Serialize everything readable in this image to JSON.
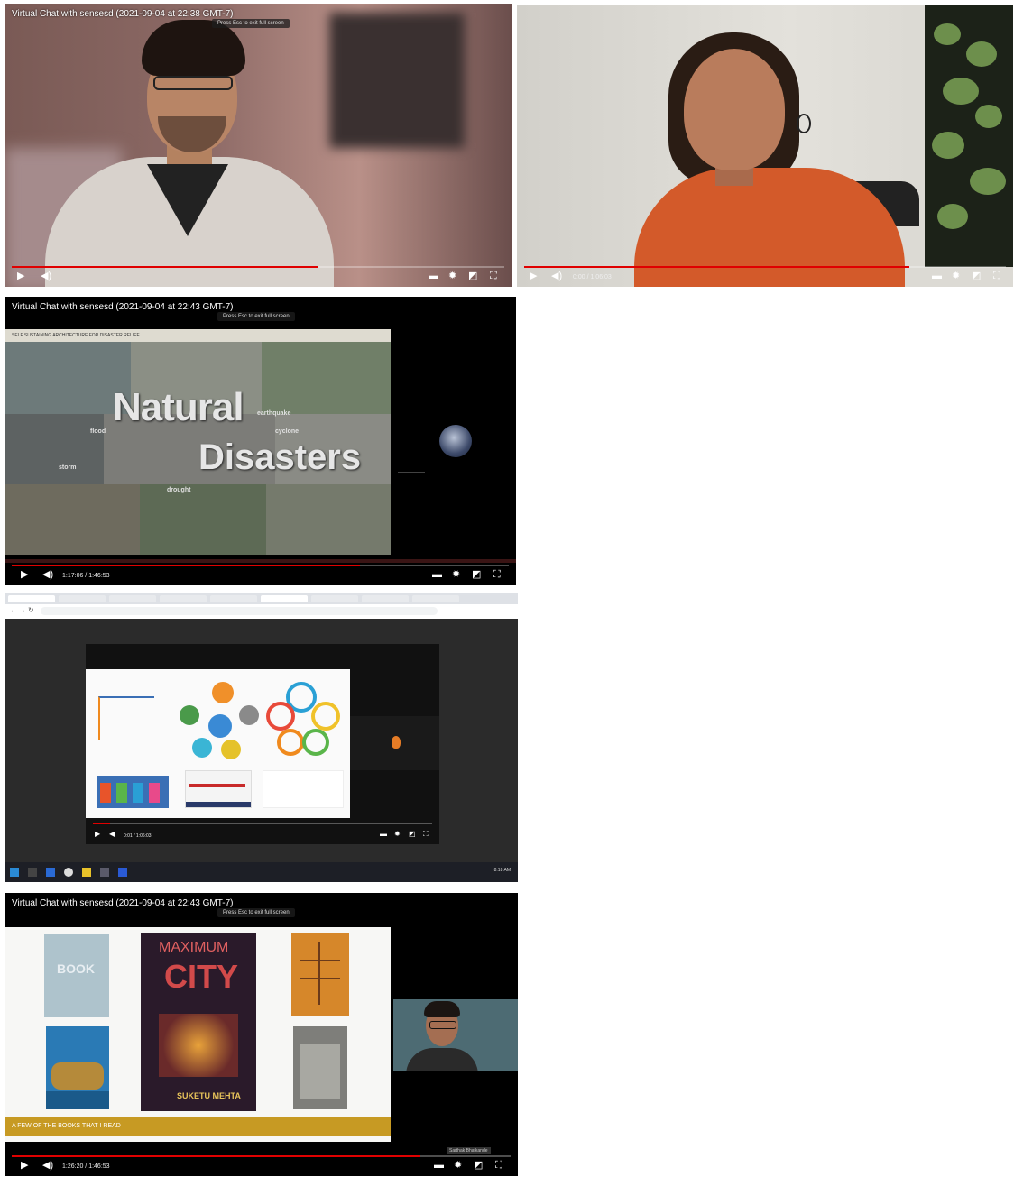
{
  "panel1": {
    "title": "Virtual Chat with sensesd (2021-09-04 at 22:38 GMT-7)",
    "hint": "Press Esc to exit full screen",
    "progress": 0.62
  },
  "panel2": {
    "time": "0:00 / 1:06:03",
    "progress": 0.8
  },
  "panel3": {
    "title": "Virtual Chat with sensesd (2021-09-04 at 22:43 GMT-7)",
    "hint": "Press Esc to exit full screen",
    "slide_banner": "SELF SUSTAINING ARCHITECTURE FOR DISASTER RELIEF",
    "word1": "Natural",
    "word2": "Disasters",
    "time": "1:17:06 / 1:46:53",
    "progress": 0.7
  },
  "panel4": {
    "time": "0:01 / 1:06:03",
    "taskbar_time": "8:18 AM",
    "progress": 0.05
  },
  "panel5": {
    "title": "Virtual Chat with sensesd (2021-09-04 at 22:43 GMT-7)",
    "hint": "Press Esc to exit full screen",
    "book_maximum": "MAXIMUM",
    "book_city": "CITY",
    "book_author": "SUKETU MEHTA",
    "gold_caption": "A FEW OF THE BOOKS THAT I READ",
    "cam_tag": "Sarthak Bhatkande",
    "time": "1:26:20 / 1:46:53",
    "progress": 0.82
  },
  "colors": {
    "progress_red": "#e00000"
  }
}
